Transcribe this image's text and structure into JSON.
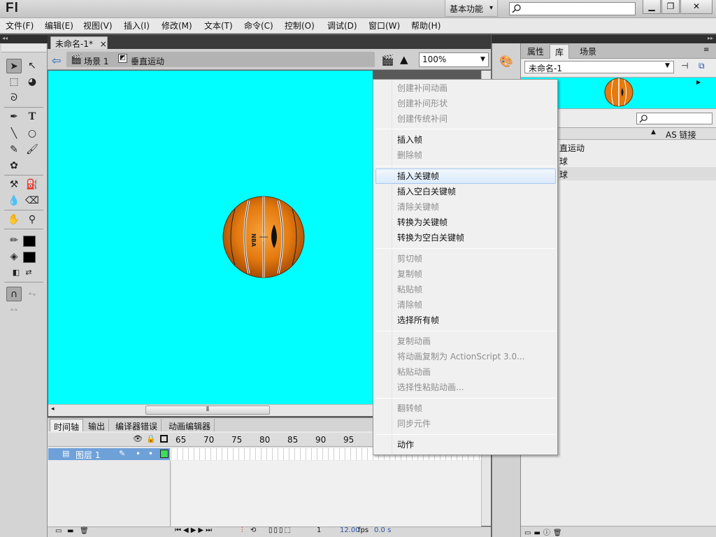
{
  "app": {
    "logo": "Fl",
    "workspace": "基本功能"
  },
  "menu": [
    "文件(F)",
    "编辑(E)",
    "视图(V)",
    "插入(I)",
    "修改(M)",
    "文本(T)",
    "命令(C)",
    "控制(O)",
    "调试(D)",
    "窗口(W)",
    "帮助(H)"
  ],
  "document": {
    "tab": "未命名-1*",
    "scene": "场景 1",
    "symbol": "垂直运动",
    "zoom": "100%"
  },
  "stage_color": "#00ffff",
  "ball": {
    "label": "NBA"
  },
  "timeline": {
    "tabs": [
      "时间轴",
      "输出",
      "编译器错误",
      "动画编辑器"
    ],
    "frame_numbers": [
      "65",
      "70",
      "75",
      "80",
      "85",
      "90",
      "95"
    ],
    "layer": "图层 1",
    "status": {
      "frame": "1",
      "fps": "12.00",
      "fps_unit": "fps",
      "time": "0.0 s"
    }
  },
  "library": {
    "tabs": [
      "属性",
      "库",
      "场景"
    ],
    "doc": "未命名-1",
    "col_header": "AS 链接",
    "items": [
      "直运动",
      "球",
      "球"
    ]
  },
  "context_menu": [
    {
      "label": "创建补间动画",
      "enabled": false
    },
    {
      "label": "创建补间形状",
      "enabled": false
    },
    {
      "label": "创建传统补间",
      "enabled": false
    },
    {
      "sep": true
    },
    {
      "label": "插入帧",
      "enabled": true
    },
    {
      "label": "删除帧",
      "enabled": false
    },
    {
      "sep": true
    },
    {
      "label": "插入关键帧",
      "enabled": true,
      "highlight": true
    },
    {
      "label": "插入空白关键帧",
      "enabled": true
    },
    {
      "label": "清除关键帧",
      "enabled": false
    },
    {
      "label": "转换为关键帧",
      "enabled": true
    },
    {
      "label": "转换为空白关键帧",
      "enabled": true
    },
    {
      "sep": true
    },
    {
      "label": "剪切帧",
      "enabled": false
    },
    {
      "label": "复制帧",
      "enabled": false
    },
    {
      "label": "粘贴帧",
      "enabled": false
    },
    {
      "label": "清除帧",
      "enabled": false
    },
    {
      "label": "选择所有帧",
      "enabled": true
    },
    {
      "sep": true
    },
    {
      "label": "复制动画",
      "enabled": false
    },
    {
      "label": "将动画复制为 ActionScript 3.0...",
      "enabled": false
    },
    {
      "label": "粘贴动画",
      "enabled": false
    },
    {
      "label": "选择性粘贴动画...",
      "enabled": false
    },
    {
      "sep": true
    },
    {
      "label": "翻转帧",
      "enabled": false
    },
    {
      "label": "同步元件",
      "enabled": false
    },
    {
      "sep": true
    },
    {
      "label": "动作",
      "enabled": true
    }
  ]
}
